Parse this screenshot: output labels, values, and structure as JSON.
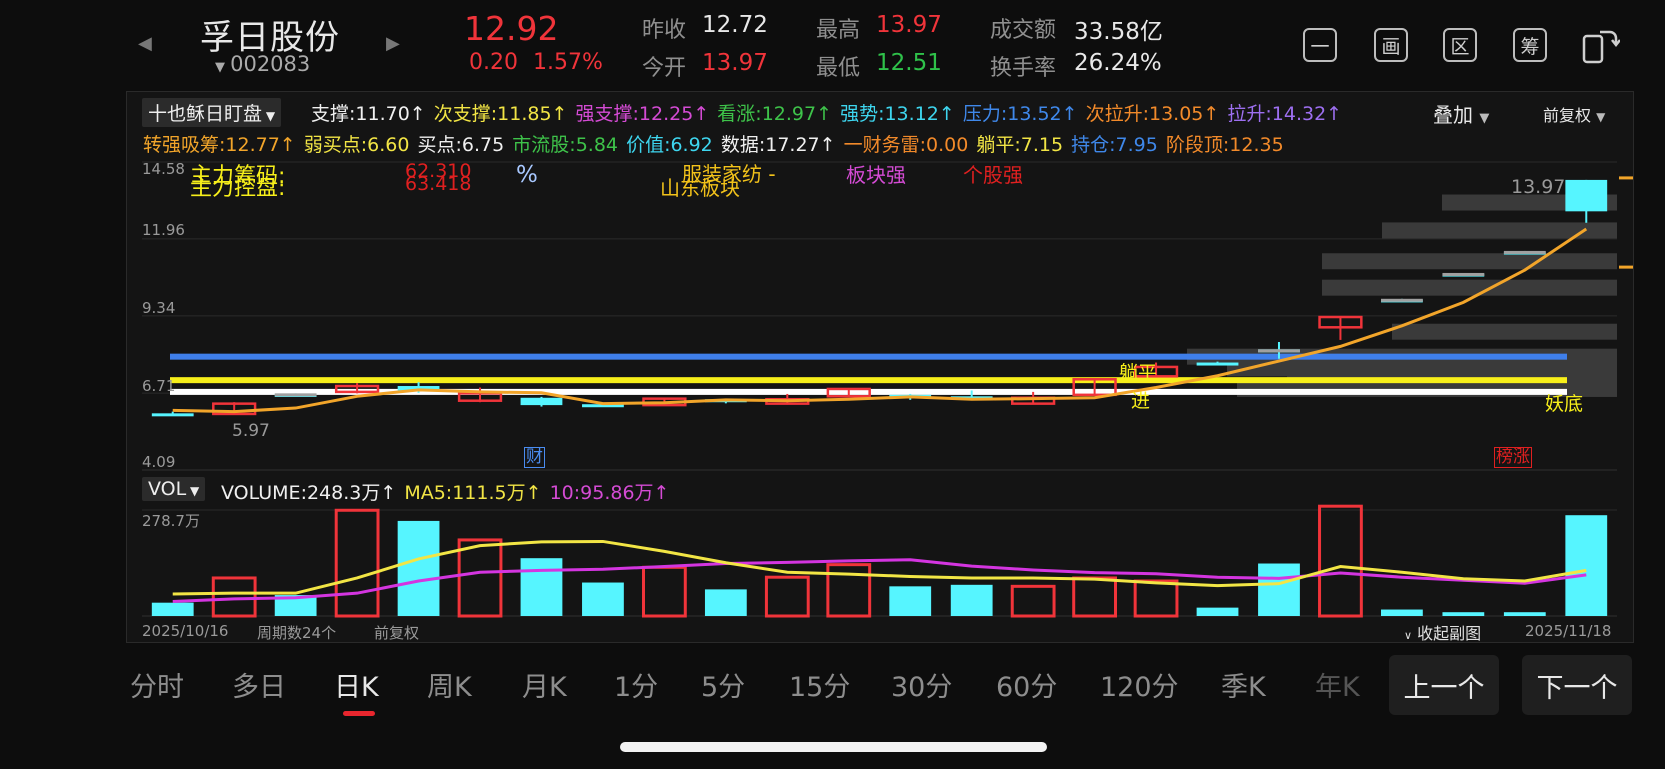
{
  "header": {
    "stock_name": "孚日股份",
    "stock_code": "002083",
    "price": "12.92",
    "change": "0.20",
    "change_pct": "1.57%",
    "prev_close_label": "昨收",
    "prev_close": "12.72",
    "open_label": "今开",
    "open": "13.97",
    "high_label": "最高",
    "high": "13.97",
    "low_label": "最低",
    "low": "12.51",
    "turnover_label": "成交额",
    "turnover": "33.58亿",
    "turnover_rate_label": "换手率",
    "turnover_rate": "26.24%",
    "tool_buttons": [
      "一",
      "画",
      "区",
      "筹"
    ]
  },
  "indicator": {
    "name": "十也稣日盯盘",
    "overlay_label": "叠加",
    "adjust_label": "前复权",
    "row1": [
      {
        "text": "支撑:11.70↑",
        "color": "#f0f0f0"
      },
      {
        "text": "次支撑:11.85↑",
        "color": "#f2e545"
      },
      {
        "text": "强支撑:12.25↑",
        "color": "#d44bd4"
      },
      {
        "text": "看涨:12.97↑",
        "color": "#3ec34a"
      },
      {
        "text": "强势:13.12↑",
        "color": "#3ed6ef"
      },
      {
        "text": "压力:13.52↑",
        "color": "#3f88ea"
      },
      {
        "text": "次拉升:13.05↑",
        "color": "#f28a2a"
      },
      {
        "text": "拉升:14.32↑",
        "color": "#9d6ff0"
      }
    ],
    "row2": [
      {
        "text": "转强吸筹:12.77↑",
        "color": "#f2a52a"
      },
      {
        "text": "弱买点:6.60",
        "color": "#f2e545"
      },
      {
        "text": "买点:6.75",
        "color": "#f0f0f0"
      },
      {
        "text": "市流股:5.84",
        "color": "#3ec34a"
      },
      {
        "text": "价值:6.92",
        "color": "#3ed6ef"
      },
      {
        "text": "数据:17.27↑",
        "color": "#f0f0f0"
      },
      {
        "text": "一财务雷:0.00",
        "color": "#f28a2a"
      },
      {
        "text": "躺平:7.15",
        "color": "#f2e545"
      },
      {
        "text": "持仓:7.95",
        "color": "#3f88ea"
      },
      {
        "text": "阶段顶:12.35",
        "color": "#f28a2a"
      }
    ],
    "notes": {
      "main_control": "主力控盘:",
      "main_chips": "主力筹码:",
      "val1": "63.418",
      "val2": "62.310",
      "pct": "%",
      "sector1": "服装家纺 -",
      "sector2": "山东板块",
      "sector_strong": "板块强",
      "stock_strong": "个股强",
      "flat": "躺平",
      "enter": "进",
      "demon_bottom": "妖底",
      "finance_tag": "财",
      "rank_tag": "榜涨",
      "low_mark": "5.97",
      "high_mark": "13.97"
    }
  },
  "chart_data": {
    "type": "candlestick",
    "y_ticks": [
      "14.58",
      "11.96",
      "9.34",
      "6.71",
      "4.09"
    ],
    "ylim": [
      4.09,
      14.58
    ],
    "candles": [
      {
        "o": 5.95,
        "c": 6.02,
        "h": 6.08,
        "l": 5.93,
        "up": false
      },
      {
        "o": 6.0,
        "c": 6.35,
        "h": 6.4,
        "l": 5.97,
        "up": true
      },
      {
        "o": 6.65,
        "c": 6.68,
        "h": 6.7,
        "l": 6.62,
        "up": false
      },
      {
        "o": 6.75,
        "c": 6.95,
        "h": 7.05,
        "l": 6.7,
        "up": true
      },
      {
        "o": 6.95,
        "c": 6.78,
        "h": 7.08,
        "l": 6.72,
        "up": false
      },
      {
        "o": 6.45,
        "c": 6.7,
        "h": 6.9,
        "l": 6.4,
        "up": true
      },
      {
        "o": 6.55,
        "c": 6.3,
        "h": 6.58,
        "l": 6.25,
        "up": false
      },
      {
        "o": 6.33,
        "c": 6.3,
        "h": 6.36,
        "l": 6.26,
        "up": false
      },
      {
        "o": 6.3,
        "c": 6.52,
        "h": 6.55,
        "l": 6.27,
        "up": true
      },
      {
        "o": 6.5,
        "c": 6.42,
        "h": 6.52,
        "l": 6.36,
        "up": false
      },
      {
        "o": 6.35,
        "c": 6.5,
        "h": 6.68,
        "l": 6.32,
        "up": true
      },
      {
        "o": 6.6,
        "c": 6.85,
        "h": 6.88,
        "l": 6.57,
        "up": true
      },
      {
        "o": 6.65,
        "c": 6.55,
        "h": 6.68,
        "l": 6.48,
        "up": false
      },
      {
        "o": 6.6,
        "c": 6.58,
        "h": 6.8,
        "l": 6.52,
        "up": false
      },
      {
        "o": 6.35,
        "c": 6.55,
        "h": 6.75,
        "l": 6.33,
        "up": true
      },
      {
        "o": 6.65,
        "c": 7.18,
        "h": 7.2,
        "l": 6.62,
        "up": true
      },
      {
        "o": 7.28,
        "c": 7.6,
        "h": 7.75,
        "l": 7.25,
        "up": true
      },
      {
        "o": 7.72,
        "c": 7.75,
        "h": 7.78,
        "l": 7.7,
        "up": false
      },
      {
        "o": 8.15,
        "c": 8.2,
        "h": 8.45,
        "l": 7.88,
        "up": false
      },
      {
        "o": 8.95,
        "c": 9.3,
        "h": 9.3,
        "l": 8.52,
        "up": true
      },
      {
        "o": 9.87,
        "c": 9.9,
        "h": 9.92,
        "l": 9.85,
        "up": false
      },
      {
        "o": 10.75,
        "c": 10.78,
        "h": 10.8,
        "l": 10.73,
        "up": false
      },
      {
        "o": 11.5,
        "c": 11.53,
        "h": 11.55,
        "l": 11.48,
        "up": false
      },
      {
        "o": 12.9,
        "c": 13.97,
        "h": 13.97,
        "l": 12.51,
        "up": false
      }
    ],
    "ma_line": [
      6.12,
      6.08,
      6.2,
      6.6,
      6.82,
      6.75,
      6.72,
      6.35,
      6.38,
      6.48,
      6.45,
      6.5,
      6.58,
      6.5,
      6.52,
      6.55,
      6.9,
      7.3,
      7.8,
      8.3,
      9.0,
      9.8,
      10.9,
      12.3
    ],
    "horizontal_lines": [
      {
        "name": "持仓",
        "value": 7.95,
        "color": "#3f7fea"
      },
      {
        "name": "躺平",
        "value": 7.15,
        "color": "#f7ef1a"
      },
      {
        "name": "买点",
        "value": 6.75,
        "color": "#ffffff"
      }
    ],
    "volume": {
      "label": "VOL",
      "volume_text": "VOLUME:248.3万↑",
      "ma5_text": "MA5:111.5万↑",
      "ma10_text": "10:95.86万↑",
      "max_label": "278.7万",
      "max": 278.7,
      "bars": [
        35,
        100,
        55,
        278,
        250,
        200,
        152,
        88,
        128,
        70,
        102,
        135,
        78,
        82,
        78,
        100,
        92,
        22,
        138,
        295,
        17,
        10,
        10,
        265
      ],
      "ma5": [
        58,
        60,
        60,
        100,
        150,
        185,
        195,
        196,
        170,
        140,
        115,
        110,
        104,
        100,
        100,
        97,
        87,
        80,
        85,
        130,
        115,
        98,
        92,
        120
      ],
      "ma10": [
        38,
        45,
        48,
        60,
        92,
        115,
        120,
        123,
        130,
        138,
        141,
        145,
        148,
        131,
        121,
        114,
        111,
        102,
        99,
        113,
        102,
        94,
        86,
        108
      ]
    },
    "x_start": "2025/10/16",
    "x_end": "2025/11/18",
    "period_count": "周期数24个",
    "adjust": "前复权",
    "collapse_label": "收起副图"
  },
  "tabs": [
    "分时",
    "多日",
    "日K",
    "周K",
    "月K",
    "1分",
    "5分",
    "15分",
    "30分",
    "60分",
    "120分",
    "季K",
    "年K"
  ],
  "active_tab": "日K",
  "nav": {
    "prev": "上一个",
    "next": "下一个"
  }
}
